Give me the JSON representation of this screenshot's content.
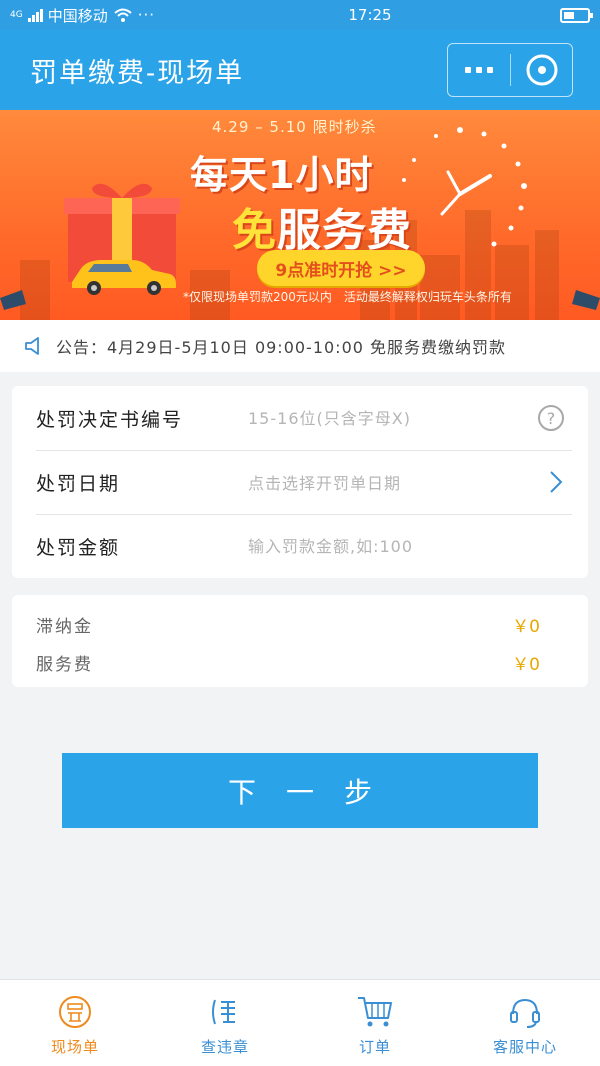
{
  "status_bar": {
    "network": "4G",
    "carrier": "中国移动",
    "time": "17:25",
    "battery_level": 0.35
  },
  "header": {
    "title": "罚单缴费-现场单",
    "more_icon": "more-dots-icon",
    "close_icon": "close-circle-icon"
  },
  "banner": {
    "date_line": "4.29 – 5.10 限时秒杀",
    "headline1": "每天1小时",
    "headline2_highlight": "免",
    "headline2_rest": "服务费",
    "cta": "9点准时开抢 >>",
    "note": "*仅限现场单罚款200元以内　活动最终解释权归玩车头条所有"
  },
  "notice": {
    "icon": "speaker-icon",
    "text": "公告：4月29日-5月10日 09:00-10:00 免服务费缴纳罚款"
  },
  "form": {
    "decision_number": {
      "label": "处罚决定书编号",
      "placeholder": "15-16位(只含字母X)",
      "value": ""
    },
    "date": {
      "label": "处罚日期",
      "placeholder": "点击选择开罚单日期"
    },
    "amount": {
      "label": "处罚金额",
      "placeholder": "输入罚款金额,如:100",
      "value": ""
    }
  },
  "fees": {
    "late_fee": {
      "label": "滞纳金",
      "value": "￥0"
    },
    "service_fee": {
      "label": "服务费",
      "value": "￥0"
    }
  },
  "next_button": "下一步",
  "tabs": [
    {
      "label": "现场单",
      "icon": "ticket-icon",
      "active": true
    },
    {
      "label": "查违章",
      "icon": "violation-search-icon",
      "active": false
    },
    {
      "label": "订单",
      "icon": "cart-icon",
      "active": false
    },
    {
      "label": "客服中心",
      "icon": "headset-icon",
      "active": false
    }
  ],
  "colors": {
    "primary": "#2aa3e8",
    "banner_orange": "#ff6a2a",
    "fee_yellow": "#e8a800",
    "tab_active": "#ef8a1e"
  }
}
